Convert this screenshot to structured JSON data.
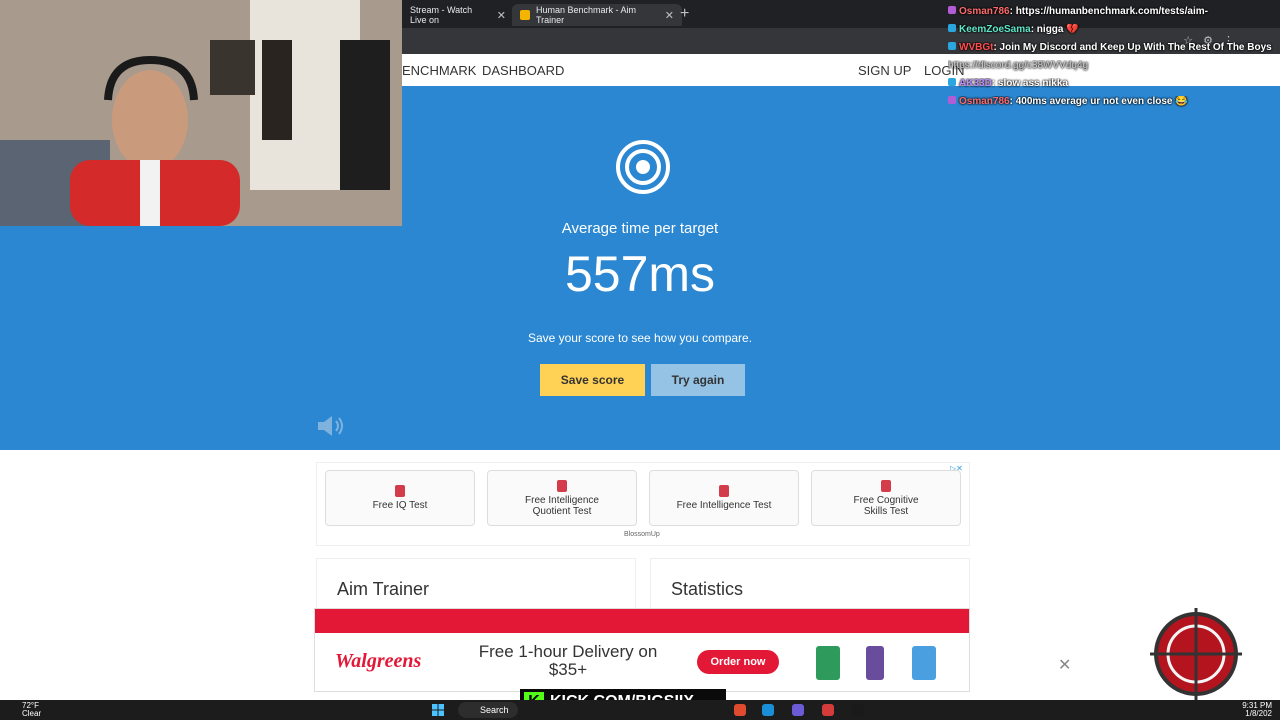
{
  "browser": {
    "tabs": [
      {
        "label": "Stream - Watch Live on"
      },
      {
        "label": "Human Benchmark - Aim Trainer"
      }
    ],
    "new_tab": "+",
    "tab_close": "✕"
  },
  "site": {
    "brand": "ENCHMARK",
    "nav_dashboard": "DASHBOARD",
    "nav_signup": "SIGN UP",
    "nav_login": "LOGIN"
  },
  "result": {
    "label": "Average time per target",
    "score": "557ms",
    "prompt": "Save your score to see how you compare.",
    "save_button": "Save score",
    "try_again_button": "Try again"
  },
  "ad_links": {
    "items": [
      {
        "label": "Free IQ Test"
      },
      {
        "label": "Free Intelligence Quotient Test"
      },
      {
        "label": "Free Intelligence Test"
      },
      {
        "label": "Free Cognitive Skills Test"
      }
    ],
    "brand": "BlossomUp"
  },
  "cards": {
    "aim_trainer": "Aim Trainer",
    "statistics": "Statistics"
  },
  "bottom_ad": {
    "brand": "Walgreens",
    "offer": "Free 1-hour Delivery on $35+",
    "order_button": "Order now"
  },
  "chat": [
    {
      "user": "Osman786",
      "message": ": https://humanbenchmark.com/tests/aim-",
      "color": "#ff6b6b"
    },
    {
      "user": "KeemZoeSama",
      "message": ": nigga 💔",
      "color": "#5ee6c8"
    },
    {
      "user": "WVBGt",
      "message": ": Join My Discord and Keep Up With The Rest Of The Boys",
      "color": "#ff4d4d"
    },
    {
      "user": "",
      "message": "https://discord.gg/c38WVVdq4g",
      "color": "#cccccc"
    },
    {
      "user": "AK33D",
      "message": ": slow ass nikka",
      "color": "#b68cff"
    },
    {
      "user": "Osman786",
      "message": ": 400ms average ur not even close 😂",
      "color": "#ff6b6b"
    }
  ],
  "overlay": {
    "kick": "KICK.COM/BIGSIIX"
  },
  "taskbar": {
    "temp": "72°F",
    "condition": "Clear",
    "search": "Search",
    "time": "9:31 PM",
    "date": "1/8/202"
  },
  "colors": {
    "hero_blue": "#2b87d1",
    "save_yellow": "#ffd154",
    "try_blue": "#95c3e6",
    "walgreens_red": "#e31837",
    "kick_green": "#53fc18"
  }
}
